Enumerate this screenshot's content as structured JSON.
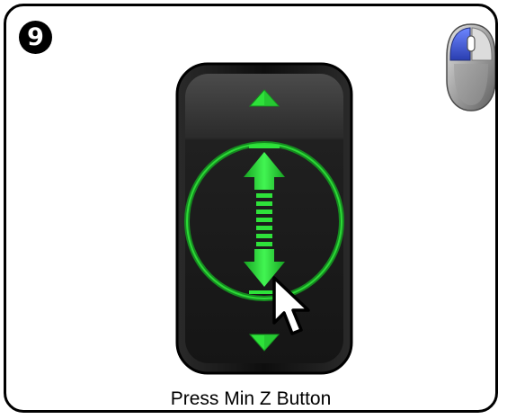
{
  "step": {
    "number": "9"
  },
  "caption": "Press Min Z Button",
  "icons": {
    "mouse": "mouse-left-click-icon",
    "controller": "z-axis-jog-controller",
    "up_arrow": "triangle-up-icon",
    "down_arrow": "triangle-down-icon",
    "cursor": "pointer-cursor-icon"
  },
  "colors": {
    "accent_green": "#1fd12a",
    "panel_dark": "#1c1c1c",
    "mouse_highlight": "#3a5bd6"
  }
}
